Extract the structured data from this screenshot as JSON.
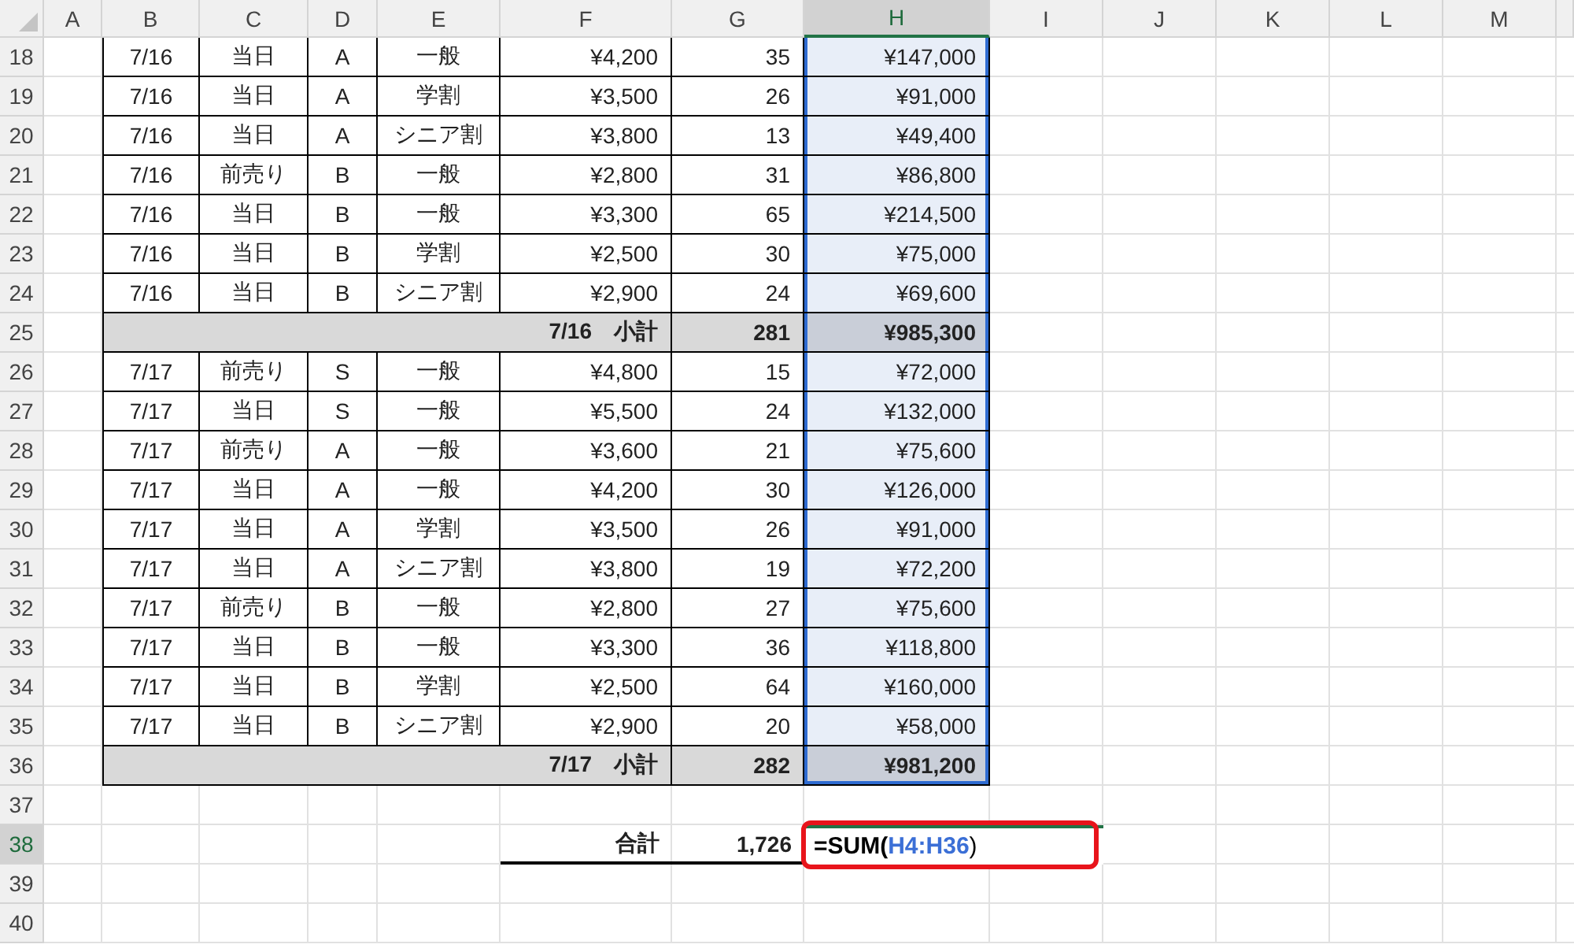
{
  "columns": [
    {
      "label": "A",
      "selected": false
    },
    {
      "label": "B",
      "selected": false
    },
    {
      "label": "C",
      "selected": false
    },
    {
      "label": "D",
      "selected": false
    },
    {
      "label": "E",
      "selected": false
    },
    {
      "label": "F",
      "selected": false
    },
    {
      "label": "G",
      "selected": false
    },
    {
      "label": "H",
      "selected": true
    },
    {
      "label": "I",
      "selected": false
    },
    {
      "label": "J",
      "selected": false
    },
    {
      "label": "K",
      "selected": false
    },
    {
      "label": "L",
      "selected": false
    },
    {
      "label": "M",
      "selected": false
    }
  ],
  "rows": [
    {
      "number": "18",
      "kind": "data",
      "in_selection": true,
      "cells": [
        "7/16",
        "当日",
        "A",
        "一般",
        "¥4,200",
        "35",
        "¥147,000"
      ]
    },
    {
      "number": "19",
      "kind": "data",
      "in_selection": true,
      "cells": [
        "7/16",
        "当日",
        "A",
        "学割",
        "¥3,500",
        "26",
        "¥91,000"
      ]
    },
    {
      "number": "20",
      "kind": "data",
      "in_selection": true,
      "cells": [
        "7/16",
        "当日",
        "A",
        "シニア割",
        "¥3,800",
        "13",
        "¥49,400"
      ]
    },
    {
      "number": "21",
      "kind": "data",
      "in_selection": true,
      "cells": [
        "7/16",
        "前売り",
        "B",
        "一般",
        "¥2,800",
        "31",
        "¥86,800"
      ]
    },
    {
      "number": "22",
      "kind": "data",
      "in_selection": true,
      "cells": [
        "7/16",
        "当日",
        "B",
        "一般",
        "¥3,300",
        "65",
        "¥214,500"
      ]
    },
    {
      "number": "23",
      "kind": "data",
      "in_selection": true,
      "cells": [
        "7/16",
        "当日",
        "B",
        "学割",
        "¥2,500",
        "30",
        "¥75,000"
      ]
    },
    {
      "number": "24",
      "kind": "data",
      "in_selection": true,
      "cells": [
        "7/16",
        "当日",
        "B",
        "シニア割",
        "¥2,900",
        "24",
        "¥69,600"
      ]
    },
    {
      "number": "25",
      "kind": "subtotal",
      "in_selection": true,
      "label": "7/16　小計",
      "count": "281",
      "amount": "¥985,300"
    },
    {
      "number": "26",
      "kind": "data",
      "in_selection": true,
      "cells": [
        "7/17",
        "前売り",
        "S",
        "一般",
        "¥4,800",
        "15",
        "¥72,000"
      ]
    },
    {
      "number": "27",
      "kind": "data",
      "in_selection": true,
      "cells": [
        "7/17",
        "当日",
        "S",
        "一般",
        "¥5,500",
        "24",
        "¥132,000"
      ]
    },
    {
      "number": "28",
      "kind": "data",
      "in_selection": true,
      "cells": [
        "7/17",
        "前売り",
        "A",
        "一般",
        "¥3,600",
        "21",
        "¥75,600"
      ]
    },
    {
      "number": "29",
      "kind": "data",
      "in_selection": true,
      "cells": [
        "7/17",
        "当日",
        "A",
        "一般",
        "¥4,200",
        "30",
        "¥126,000"
      ]
    },
    {
      "number": "30",
      "kind": "data",
      "in_selection": true,
      "cells": [
        "7/17",
        "当日",
        "A",
        "学割",
        "¥3,500",
        "26",
        "¥91,000"
      ]
    },
    {
      "number": "31",
      "kind": "data",
      "in_selection": true,
      "cells": [
        "7/17",
        "当日",
        "A",
        "シニア割",
        "¥3,800",
        "19",
        "¥72,200"
      ]
    },
    {
      "number": "32",
      "kind": "data",
      "in_selection": true,
      "cells": [
        "7/17",
        "前売り",
        "B",
        "一般",
        "¥2,800",
        "27",
        "¥75,600"
      ]
    },
    {
      "number": "33",
      "kind": "data",
      "in_selection": true,
      "cells": [
        "7/17",
        "当日",
        "B",
        "一般",
        "¥3,300",
        "36",
        "¥118,800"
      ]
    },
    {
      "number": "34",
      "kind": "data",
      "in_selection": true,
      "cells": [
        "7/17",
        "当日",
        "B",
        "学割",
        "¥2,500",
        "64",
        "¥160,000"
      ]
    },
    {
      "number": "35",
      "kind": "data",
      "in_selection": true,
      "cells": [
        "7/17",
        "当日",
        "B",
        "シニア割",
        "¥2,900",
        "20",
        "¥58,000"
      ]
    },
    {
      "number": "36",
      "kind": "subtotal",
      "in_selection": true,
      "label": "7/17　小計",
      "count": "282",
      "amount": "¥981,200"
    },
    {
      "number": "37",
      "kind": "blank"
    },
    {
      "number": "38",
      "kind": "total",
      "label": "合計",
      "count": "1,726",
      "formula": {
        "function": "=SUM(",
        "range": "H4:H36",
        "close": ")"
      }
    },
    {
      "number": "39",
      "kind": "blank"
    },
    {
      "number": "40",
      "kind": "blank"
    }
  ]
}
